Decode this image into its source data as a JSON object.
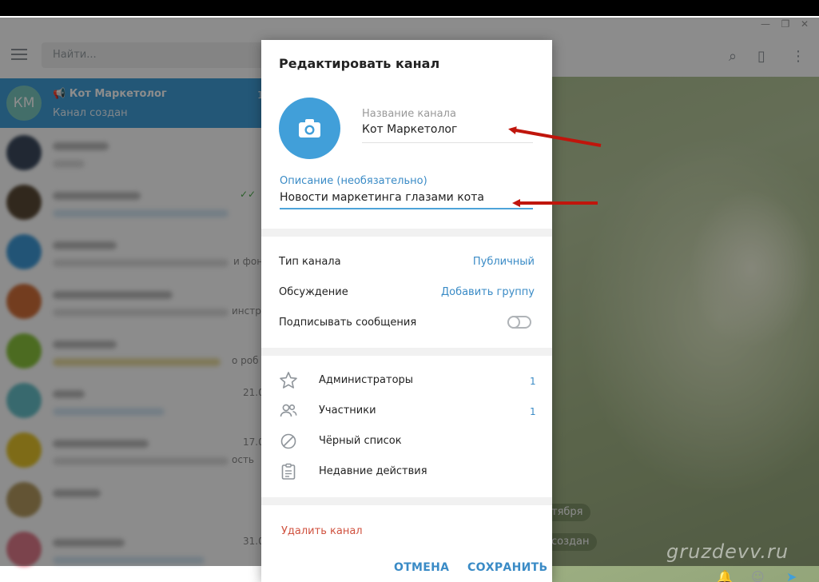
{
  "window": {
    "minimize": "—",
    "restore": "❐",
    "close": "✕"
  },
  "sidebar": {
    "search_placeholder": "Найти...",
    "active_chat": {
      "initials": "КМ",
      "name": "Кот Маркетолог",
      "subtitle": "Канал создан",
      "count": "1"
    },
    "visible_fragments": {
      "row3": "и фон",
      "row4": "инстр",
      "row5": "о роб",
      "row6_time": "21.0",
      "row7_time": "17.0",
      "row7_text": "ость",
      "row9_time": "31.0"
    }
  },
  "chat_area": {
    "date_pill": "тября",
    "system_pill": "создан",
    "watermark": "gruzdevv.ru"
  },
  "dialog": {
    "title": "Редактировать канал",
    "name_label": "Название канала",
    "name_value": "Кот Маркетолог",
    "description_label": "Описание (необязательно)",
    "description_value": "Новости маркетинга глазами кота",
    "channel_type_label": "Тип канала",
    "channel_type_value": "Публичный",
    "discussion_label": "Обсуждение",
    "discussion_value": "Добавить группу",
    "sign_messages_label": "Подписывать сообщения",
    "sign_messages_enabled": false,
    "admins_label": "Администраторы",
    "admins_count": "1",
    "members_label": "Участники",
    "members_count": "1",
    "blacklist_label": "Чёрный список",
    "recent_actions_label": "Недавние действия",
    "delete_label": "Удалить канал",
    "cancel_label": "ОТМЕНА",
    "save_label": "СОХРАНИТЬ"
  },
  "colors": {
    "accent": "#419fd9",
    "link": "#3a8bc6",
    "danger": "#d0523f",
    "arrow": "#c0150c"
  }
}
